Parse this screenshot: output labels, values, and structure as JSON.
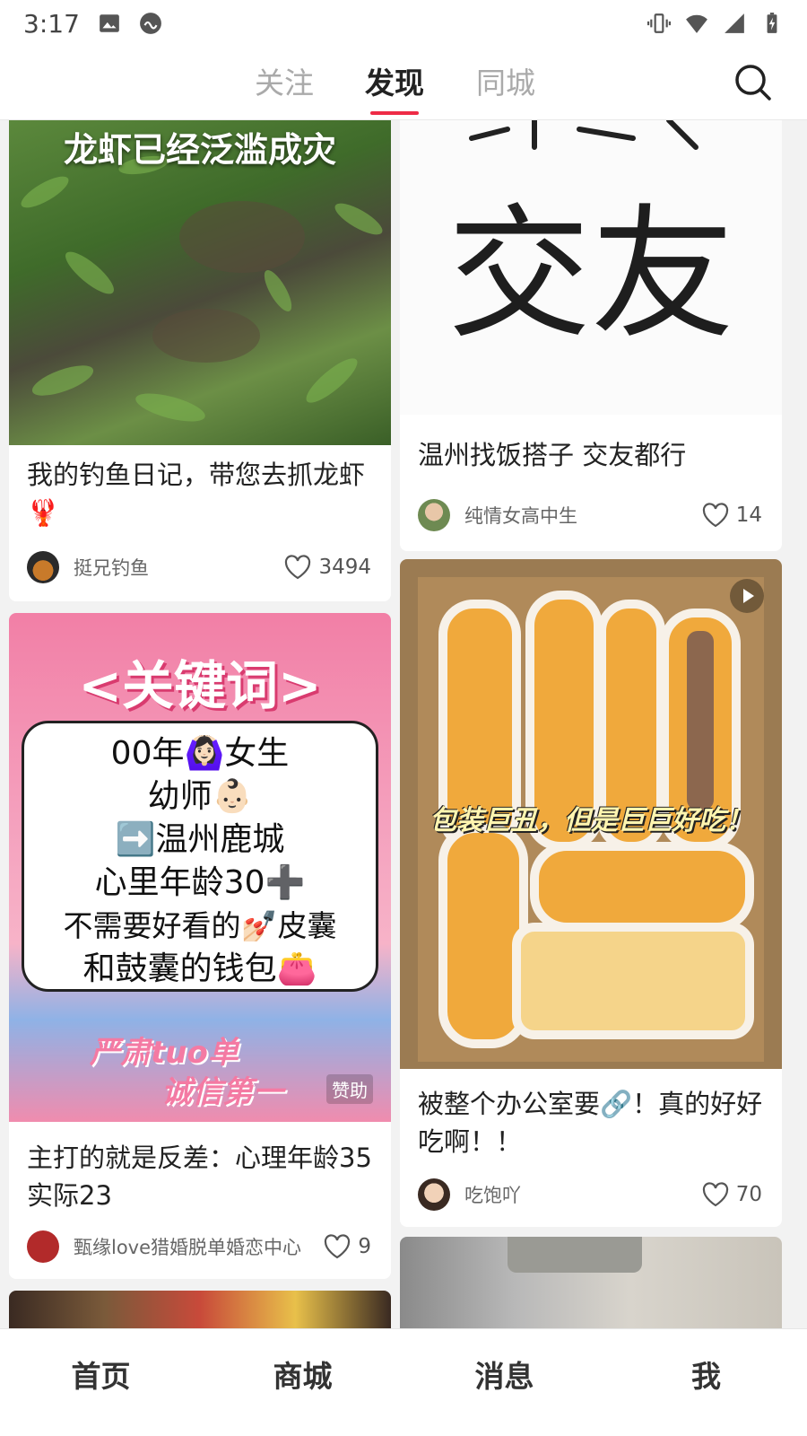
{
  "status_bar": {
    "time": "3:17",
    "icons": [
      "image-icon",
      "app-icon",
      "vibrate-icon",
      "wifi-icon",
      "signal-icon",
      "battery-icon"
    ]
  },
  "top_nav": {
    "tabs": [
      {
        "label": "关注",
        "active": false
      },
      {
        "label": "发现",
        "active": true
      },
      {
        "label": "同城",
        "active": false
      }
    ],
    "accent_color": "#ee2b46",
    "search_icon": "search-icon"
  },
  "feed": {
    "cards": [
      {
        "image_caption": "龙虾已经泛滥成灾",
        "title": "我的钓鱼日记，带您去抓龙虾🦞",
        "author": "挺兄钓鱼",
        "likes": "3494"
      },
      {
        "image_text": "交友",
        "title": "温州找饭搭子 交友都行",
        "author": "纯情女高中生",
        "likes": "14"
      },
      {
        "image_lines": [
          "<关键词>",
          "00年🙆🏻‍♀️女生",
          "幼师👶🏻",
          "➡️温州鹿城",
          "心里年龄30➕",
          "不需要好看的💅🏻皮囊",
          "和鼓囊的钱包👛",
          "严肃tuo单",
          "诚信第一"
        ],
        "badge": "赞助",
        "title": "主打的就是反差：心理年龄35 实际23",
        "author": "甄缘love猎婚脱单婚恋中心",
        "likes": "9"
      },
      {
        "image_caption": "包装巨丑，但是巨巨好吃！",
        "title": "被整个办公室要🔗！真的好好吃啊！！",
        "author": "吃饱吖",
        "likes": "70"
      }
    ]
  },
  "bottom_nav": {
    "items": [
      "首页",
      "商城",
      "消息",
      "我"
    ]
  }
}
